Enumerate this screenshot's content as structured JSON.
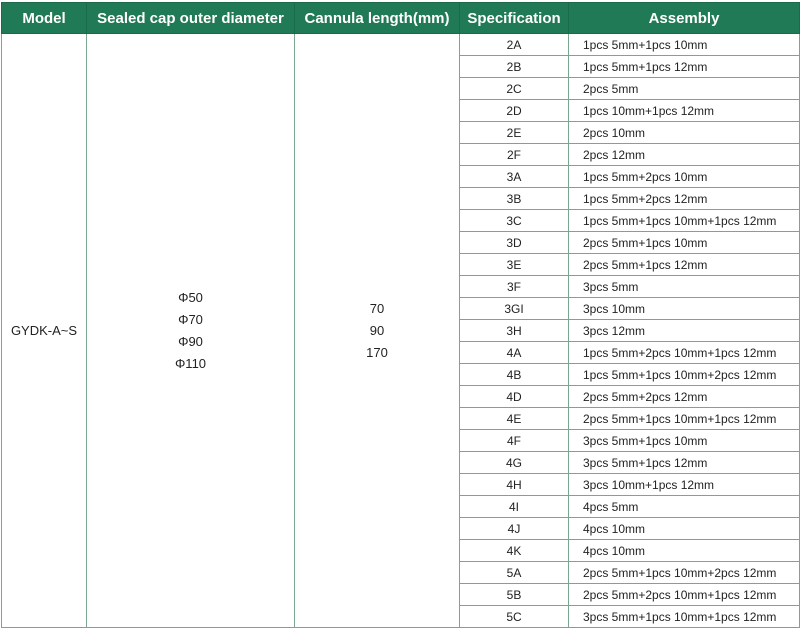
{
  "header": {
    "model": "Model",
    "diameter": "Sealed cap outer diameter",
    "cannula": "Cannula length(mm)",
    "specification": "Specification",
    "assembly": "Assembly"
  },
  "model": "GYDK-A~S",
  "diameters": [
    "Φ50",
    "Φ70",
    "Φ90",
    "Φ110"
  ],
  "cannula_lengths": [
    "70",
    "90",
    "170"
  ],
  "rows": [
    {
      "spec": "2A",
      "assembly": "1pcs 5mm+1pcs 10mm"
    },
    {
      "spec": "2B",
      "assembly": "1pcs 5mm+1pcs 12mm"
    },
    {
      "spec": "2C",
      "assembly": "2pcs 5mm"
    },
    {
      "spec": "2D",
      "assembly": "1pcs 10mm+1pcs 12mm"
    },
    {
      "spec": "2E",
      "assembly": "2pcs 10mm"
    },
    {
      "spec": "2F",
      "assembly": "2pcs 12mm"
    },
    {
      "spec": "3A",
      "assembly": "1pcs 5mm+2pcs 10mm"
    },
    {
      "spec": "3B",
      "assembly": "1pcs 5mm+2pcs 12mm"
    },
    {
      "spec": "3C",
      "assembly": "1pcs 5mm+1pcs 10mm+1pcs 12mm"
    },
    {
      "spec": "3D",
      "assembly": "2pcs 5mm+1pcs 10mm"
    },
    {
      "spec": "3E",
      "assembly": "2pcs 5mm+1pcs 12mm"
    },
    {
      "spec": "3F",
      "assembly": "3pcs 5mm"
    },
    {
      "spec": "3GI",
      "assembly": "3pcs 10mm"
    },
    {
      "spec": "3H",
      "assembly": "3pcs 12mm"
    },
    {
      "spec": "4A",
      "assembly": "1pcs 5mm+2pcs 10mm+1pcs 12mm"
    },
    {
      "spec": "4B",
      "assembly": "1pcs 5mm+1pcs 10mm+2pcs 12mm"
    },
    {
      "spec": "4D",
      "assembly": "2pcs 5mm+2pcs 12mm"
    },
    {
      "spec": "4E",
      "assembly": "2pcs 5mm+1pcs 10mm+1pcs 12mm"
    },
    {
      "spec": "4F",
      "assembly": "3pcs 5mm+1pcs 10mm"
    },
    {
      "spec": "4G",
      "assembly": "3pcs 5mm+1pcs 12mm"
    },
    {
      "spec": "4H",
      "assembly": "3pcs 10mm+1pcs 12mm"
    },
    {
      "spec": "4I",
      "assembly": "4pcs 5mm"
    },
    {
      "spec": "4J",
      "assembly": "4pcs 10mm"
    },
    {
      "spec": "4K",
      "assembly": "4pcs 10mm"
    },
    {
      "spec": "5A",
      "assembly": "2pcs 5mm+1pcs 10mm+2pcs 12mm"
    },
    {
      "spec": "5B",
      "assembly": "2pcs 5mm+2pcs 10mm+1pcs 12mm"
    },
    {
      "spec": "5C",
      "assembly": "3pcs 5mm+1pcs 10mm+1pcs 12mm"
    }
  ],
  "colors": {
    "header_bg": "#207a55",
    "header_text": "#ffffff",
    "grid": "#79a68f"
  }
}
